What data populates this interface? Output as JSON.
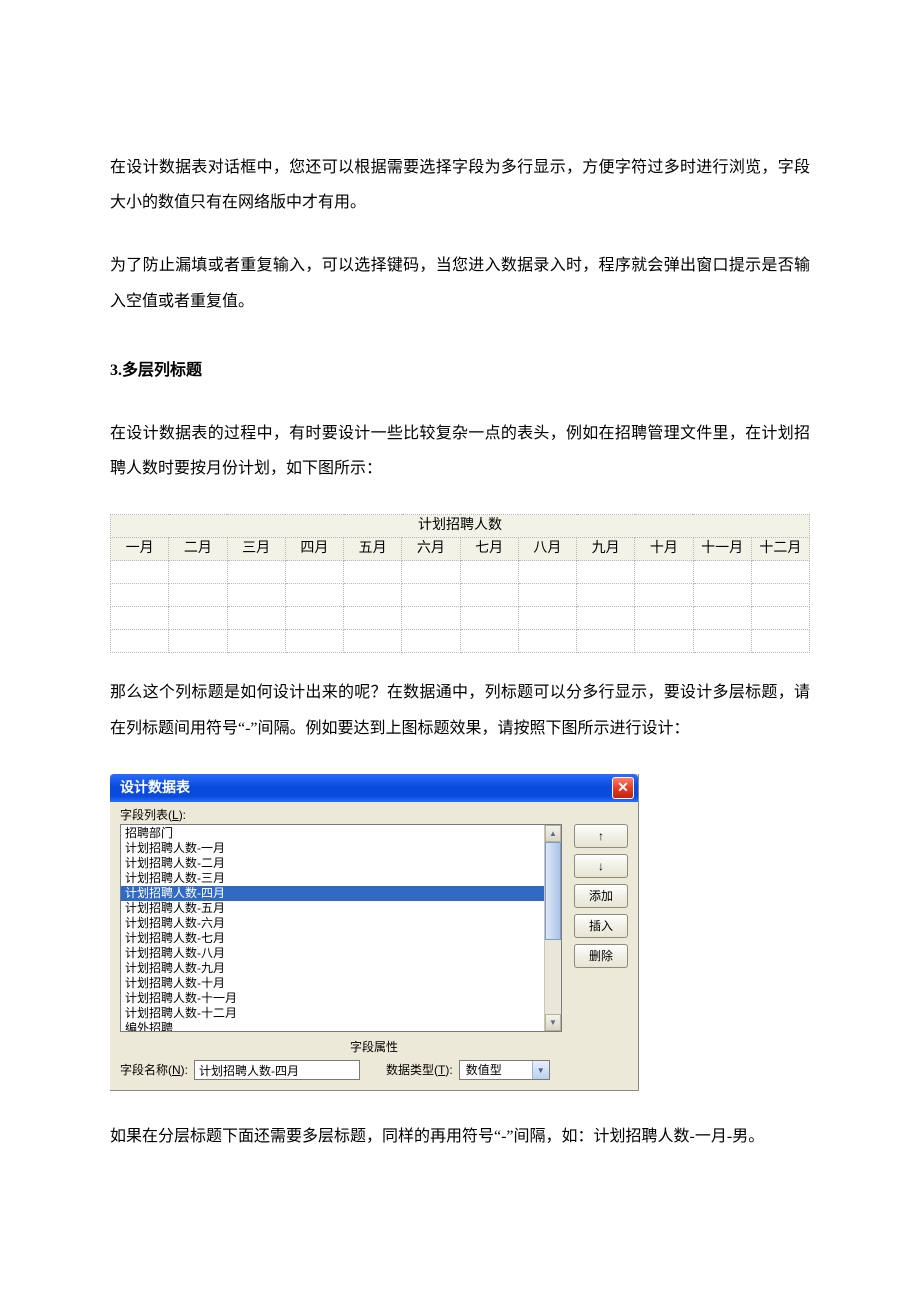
{
  "para1": "在设计数据表对话框中，您还可以根据需要选择字段为多行显示，方便字符过多时进行浏览，字段大小的数值只有在网络版中才有用。",
  "para2": "为了防止漏填或者重复输入，可以选择键码，当您进入数据录入时，程序就会弹出窗口提示是否输入空值或者重复值。",
  "heading": "3.多层列标题",
  "para3": "在设计数据表的过程中，有时要设计一些比较复杂一点的表头，例如在招聘管理文件里，在计划招聘人数时要按月份计划，如下图所示：",
  "table": {
    "top": "计划招聘人数",
    "months": [
      "一月",
      "二月",
      "三月",
      "四月",
      "五月",
      "六月",
      "七月",
      "八月",
      "九月",
      "十月",
      "十一月",
      "十二月"
    ]
  },
  "para4": "那么这个列标题是如何设计出来的呢？在数据通中，列标题可以分多行显示，要设计多层标题，请在列标题间用符号“-”间隔。例如要达到上图标题效果，请按照下图所示进行设计：",
  "dialog": {
    "title": "设计数据表",
    "fieldListLabelPrefix": "字段列表(",
    "fieldListLabelKey": "L",
    "fieldListLabelSuffix": "):",
    "items": [
      "招聘部门",
      "计划招聘人数-一月",
      "计划招聘人数-二月",
      "计划招聘人数-三月",
      "计划招聘人数-四月",
      "计划招聘人数-五月",
      "计划招聘人数-六月",
      "计划招聘人数-七月",
      "计划招聘人数-八月",
      "计划招聘人数-九月",
      "计划招聘人数-十月",
      "计划招聘人数-十一月",
      "计划招聘人数-十二月",
      "编外招聘"
    ],
    "selectedIndex": 4,
    "buttons": {
      "moveUp": "↑",
      "moveDown": "↓",
      "add": "添加",
      "insert": "插入",
      "delete": "删除"
    },
    "propsTitle": "字段属性",
    "fieldNameLabelPrefix": "字段名称(",
    "fieldNameLabelKey": "N",
    "fieldNameLabelSuffix": "):",
    "fieldNameValue": "计划招聘人数-四月",
    "dataTypeLabelPrefix": "数据类型(",
    "dataTypeLabelKey": "T",
    "dataTypeLabelSuffix": "):",
    "dataTypeValue": "数值型"
  },
  "para5": "如果在分层标题下面还需要多层标题，同样的再用符号“-”间隔，如：计划招聘人数-一月-男。"
}
